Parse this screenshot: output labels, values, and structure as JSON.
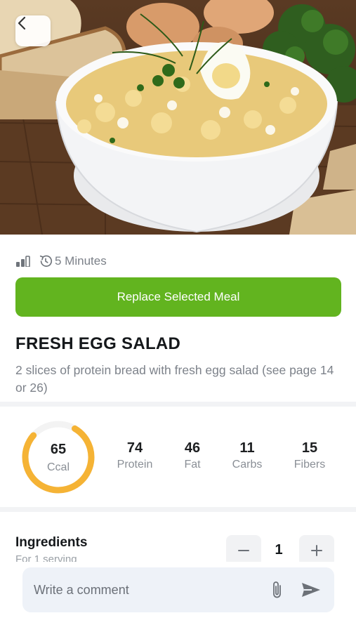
{
  "meta": {
    "time_text": "5 Minutes"
  },
  "cta": {
    "label": "Replace Selected Meal"
  },
  "meal": {
    "title": "FRESH EGG SALAD",
    "description": "2 slices of protein bread with fresh egg salad (see page 14 or 26)"
  },
  "nutrition": {
    "calories": {
      "value": "65",
      "label": "Ccal",
      "ring_fraction": 0.78
    },
    "stats": [
      {
        "value": "74",
        "label": "Protein"
      },
      {
        "value": "46",
        "label": "Fat"
      },
      {
        "value": "11",
        "label": "Carbs"
      },
      {
        "value": "15",
        "label": "Fibers"
      }
    ]
  },
  "ingredients": {
    "title": "Ingredients",
    "subtitle": "For 1 serving",
    "quantity": "1"
  },
  "comment": {
    "placeholder": "Write a comment"
  },
  "colors": {
    "accent_green": "#62b41f",
    "ring_orange": "#f5b335"
  },
  "icons": [
    "chevron-left-icon",
    "difficulty-bars-icon",
    "clock-icon",
    "minus-icon",
    "plus-icon",
    "paperclip-icon",
    "send-icon"
  ]
}
